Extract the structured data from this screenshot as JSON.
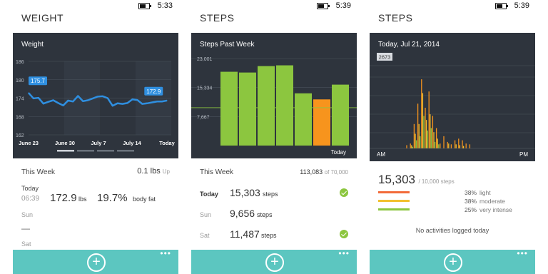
{
  "screens": [
    {
      "status_time": "5:33",
      "title": "WEIGHT",
      "chart_title": "Weight",
      "chart_data": {
        "type": "line",
        "y_ticks": [
          "186",
          "180",
          "174",
          "168",
          "162"
        ],
        "x_labels": [
          "June 23",
          "June 30",
          "July 7",
          "July 14",
          "Today"
        ],
        "x": [
          0,
          1,
          2,
          3,
          4,
          5,
          6,
          7,
          8,
          9,
          10,
          11,
          12,
          13,
          14,
          15,
          16,
          17,
          18,
          19,
          20,
          21,
          22,
          23,
          24,
          25,
          26,
          27,
          28
        ],
        "values": [
          175.7,
          173.9,
          174.1,
          172.2,
          172.8,
          173.3,
          172.4,
          171.6,
          173.2,
          172.9,
          174.7,
          173.0,
          173.3,
          173.9,
          174.5,
          174.6,
          174.0,
          171.5,
          172.3,
          172.1,
          172.4,
          173.6,
          173.4,
          172.1,
          172.3,
          172.6,
          172.9,
          172.9,
          173.2
        ],
        "ylim": [
          162,
          186
        ],
        "callouts": [
          "175.7",
          "172.9"
        ]
      },
      "summary": {
        "label": "This Week",
        "value": "0.1 lbs",
        "trend": "Up"
      },
      "today_label": "Today",
      "entry": {
        "time": "06:39",
        "weight": "172.9",
        "weight_unit": "lbs",
        "bodyfat": "19.7%",
        "bodyfat_label": "body fat"
      },
      "sun_label": "Sun",
      "sun_value": "—",
      "sat_label": "Sat"
    },
    {
      "status_time": "5:39",
      "title": "STEPS",
      "chart_title": "Steps Past Week",
      "chart_data": {
        "type": "bar",
        "y_ticks": [
          "23,001",
          "15,334",
          "7,667"
        ],
        "values": [
          19500,
          19300,
          21000,
          21200,
          13800,
          12200,
          16100
        ],
        "colors": [
          "#8cc63f",
          "#8cc63f",
          "#8cc63f",
          "#8cc63f",
          "#8cc63f",
          "#f7941d",
          "#8cc63f"
        ],
        "x_label_last": "Today",
        "goal": 10000,
        "ylim": [
          0,
          23001
        ]
      },
      "summary": {
        "label": "This Week",
        "value": "113,083",
        "of": "of 70,000"
      },
      "days": [
        {
          "day": "Today",
          "value": "15,303",
          "unit": "steps",
          "goal_met": true
        },
        {
          "day": "Sun",
          "value": "9,656",
          "unit": "steps",
          "goal_met": false
        },
        {
          "day": "Sat",
          "value": "11,487",
          "unit": "steps",
          "goal_met": true
        }
      ]
    },
    {
      "status_time": "5:39",
      "title": "STEPS",
      "chart_title": "Today, Jul 21, 2014",
      "chart_data": {
        "type": "bar",
        "peak_label": "2673",
        "x_labels": [
          "AM",
          "PM"
        ],
        "series": [
          {
            "name": "light",
            "color": "#f7941d",
            "values": [
              0.04,
              0.06,
              0.3,
              0.55,
              0.85,
              0.5,
              0.7,
              0.4,
              0.25,
              0.06,
              0.15,
              0.08,
              0.05,
              0.1,
              0.12,
              0.1,
              0.06,
              0.05
            ]
          },
          {
            "name": "moderate",
            "color": "#f2c12e",
            "values": [
              0.0,
              0.04,
              0.18,
              0.3,
              0.68,
              0.35,
              0.42,
              0.2,
              0.12,
              0.0,
              0.0,
              0.06,
              0.0,
              0.05,
              0.04,
              0.03,
              0.0,
              0.0
            ]
          },
          {
            "name": "very intense",
            "color": "#8cc63f",
            "values": [
              0.0,
              0.02,
              0.1,
              0.15,
              0.4,
              0.22,
              0.25,
              0.08,
              0.05,
              0.0,
              0.0,
              0.0,
              0.0,
              0.0,
              0.0,
              0.0,
              0.0,
              0.0
            ]
          }
        ]
      },
      "total": "15,303",
      "goal": "/ 10,000 steps",
      "legend": [
        {
          "pct": "38%",
          "label": "light",
          "color": "#f26b3a"
        },
        {
          "pct": "38%",
          "label": "moderate",
          "color": "#f2c12e"
        },
        {
          "pct": "25%",
          "label": "very intense",
          "color": "#8cc63f"
        }
      ],
      "no_activity": "No activities logged today"
    }
  ],
  "bottom_bar": {
    "more_label": "•••"
  }
}
